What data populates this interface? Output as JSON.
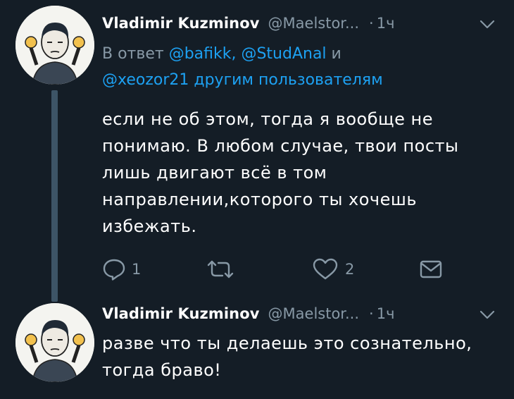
{
  "tweets": [
    {
      "author_name": "Vladimir Kuzminov",
      "author_handle": "@Maelstor...",
      "dot": "·",
      "time": "1ч",
      "reply_prefix": "В ответ",
      "reply_mentions_line1": "@bafikk, @StudAnal",
      "reply_conj": "и",
      "reply_mentions_line2": "@xeozor21 другим пользователям",
      "text": "если не об этом, тогда я вообще не понимаю. В любом случае, твои посты лишь двигают всё в том направлении,которого ты хочешь избежать.",
      "reply_count": "1",
      "retweet_count": "",
      "like_count": "2"
    },
    {
      "author_name": "Vladimir Kuzminov",
      "author_handle": "@Maelstor...",
      "dot": "·",
      "time": "1ч",
      "text": "разве что ты делаешь это сознательно, тогда браво!"
    }
  ],
  "colors": {
    "background": "#141d26",
    "text": "#ffffff",
    "muted": "#8899a6",
    "link": "#1da1f2",
    "thread_line": "#3d5466"
  },
  "icons": {
    "reply": "speech-bubble-icon",
    "retweet": "retweet-icon",
    "like": "heart-icon",
    "dm": "envelope-icon",
    "menu": "chevron-down-icon"
  }
}
